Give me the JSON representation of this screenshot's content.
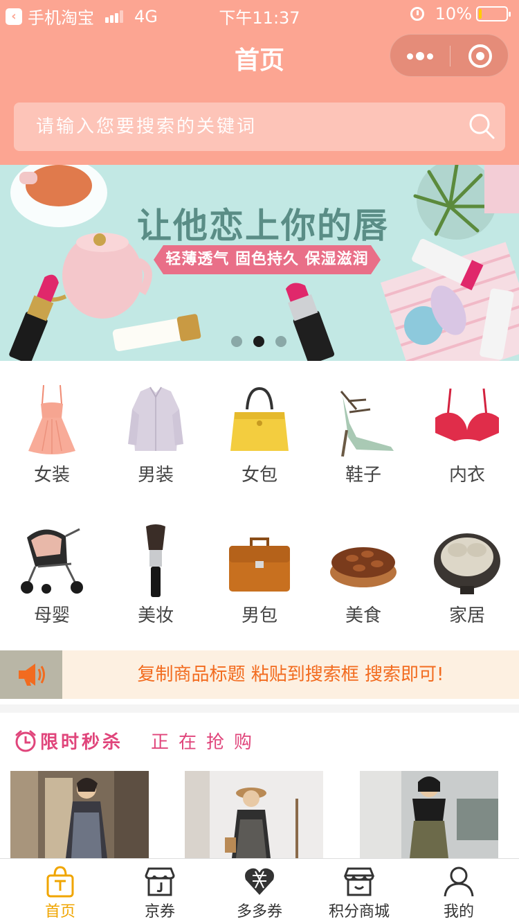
{
  "status_bar": {
    "back_app": "手机淘宝",
    "network": "4G",
    "time": "下午11:37",
    "battery": "10%",
    "battery_level": 0.1
  },
  "nav": {
    "title": "首页",
    "more_icon": "ellipsis-icon",
    "close_icon": "record-circle-icon"
  },
  "search": {
    "placeholder": "请输入您要搜索的关键词",
    "value": "",
    "icon": "search-icon"
  },
  "banner": {
    "headline": "让他恋上你的唇",
    "subline": "轻薄透气 固色持久 保湿滋润",
    "slide_count": 3,
    "active_slide": 2
  },
  "categories": [
    {
      "label": "女装",
      "icon": "dress-icon"
    },
    {
      "label": "男装",
      "icon": "shirt-icon"
    },
    {
      "label": "女包",
      "icon": "handbag-icon"
    },
    {
      "label": "鞋子",
      "icon": "high-heel-icon"
    },
    {
      "label": "内衣",
      "icon": "bra-icon"
    },
    {
      "label": "母婴",
      "icon": "stroller-icon"
    },
    {
      "label": "美妆",
      "icon": "makeup-brush-icon"
    },
    {
      "label": "男包",
      "icon": "briefcase-icon"
    },
    {
      "label": "美食",
      "icon": "nuts-icon"
    },
    {
      "label": "家居",
      "icon": "rattan-chair-icon"
    }
  ],
  "notice": {
    "text": "复制商品标题 粘贴到搜索框 搜索即可!",
    "icon": "megaphone-icon"
  },
  "flash_sale": {
    "title": "限时秒杀",
    "subtitle": "正在抢购",
    "icon": "clock-icon"
  },
  "tabbar": [
    {
      "label": "首页",
      "icon": "shopping-bag-icon",
      "active": true
    },
    {
      "label": "京券",
      "icon": "jd-store-icon",
      "active": false
    },
    {
      "label": "多多券",
      "icon": "pdd-heart-icon",
      "active": false
    },
    {
      "label": "积分商城",
      "icon": "storefront-icon",
      "active": false
    },
    {
      "label": "我的",
      "icon": "user-icon",
      "active": false
    }
  ],
  "colors": {
    "header": "#fca592",
    "notice_text": "#f26b1f",
    "flash_accent": "#e0457b",
    "tab_active": "#f0a500"
  }
}
